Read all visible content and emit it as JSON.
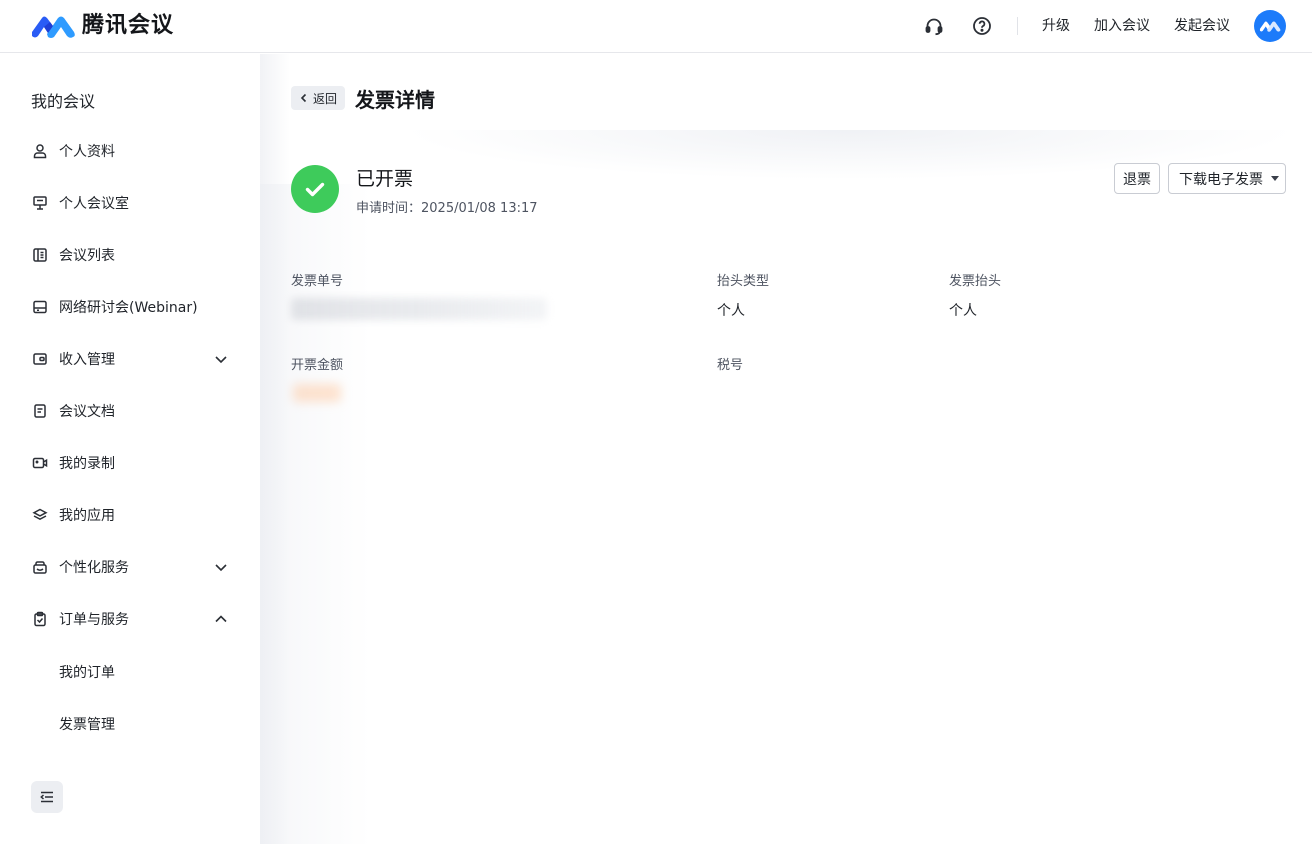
{
  "header": {
    "brand_name": "腾讯会议",
    "icons": [
      "headset-icon",
      "help-icon"
    ],
    "links": {
      "upgrade": "升级",
      "join_meeting": "加入会议",
      "start_meeting": "发起会议"
    }
  },
  "sidebar": {
    "title": "我的会议",
    "items": [
      {
        "label": "个人资料",
        "icon": "user-icon"
      },
      {
        "label": "个人会议室",
        "icon": "presentation-icon"
      },
      {
        "label": "会议列表",
        "icon": "list-icon"
      },
      {
        "label": "网络研讨会(Webinar)",
        "icon": "webinar-icon"
      },
      {
        "label": "收入管理",
        "icon": "wallet-icon",
        "expanded": false
      },
      {
        "label": "会议文档",
        "icon": "document-icon"
      },
      {
        "label": "我的录制",
        "icon": "video-icon"
      },
      {
        "label": "我的应用",
        "icon": "layers-icon"
      },
      {
        "label": "个性化服务",
        "icon": "service-icon",
        "expanded": false
      },
      {
        "label": "订单与服务",
        "icon": "clipboard-icon",
        "expanded": true
      }
    ],
    "sub_items": [
      "我的订单",
      "发票管理"
    ]
  },
  "main": {
    "back_label": "返回",
    "page_title": "发票详情",
    "status": {
      "title": "已开票",
      "time_label": "申请时间：2025/01/08 13:17"
    },
    "buttons": {
      "refund": "退票",
      "download": "下载电子发票"
    },
    "fields": {
      "invoice_no_label": "发票单号",
      "title_type_label": "抬头类型",
      "title_type_value": "个人",
      "invoice_title_label": "发票抬头",
      "invoice_title_value": "个人",
      "amount_label": "开票金额",
      "tax_no_label": "税号"
    }
  },
  "colors": {
    "accent": "#1c7bfa",
    "success": "#3ecb5b",
    "text": "#1f2329",
    "muted": "#4e5461"
  }
}
